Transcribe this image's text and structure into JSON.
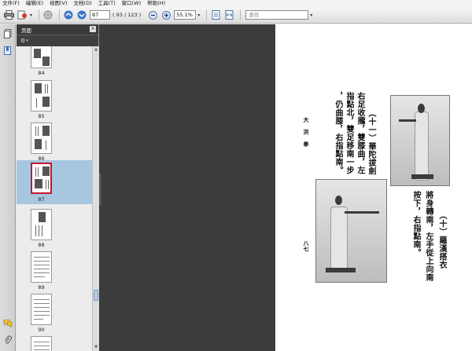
{
  "menu": [
    "文件(F)",
    "编辑(E)",
    "视图(V)",
    "文档(D)",
    "工具(T)",
    "窗口(W)",
    "帮助(H)"
  ],
  "toolbar": {
    "current_page": "87",
    "page_of": "( 93 / 123 )",
    "zoom": "55.1%",
    "find_placeholder": "查找"
  },
  "panel": {
    "title": "页面",
    "close_label": "×"
  },
  "thumbnails": [
    {
      "label": "84",
      "selected": false
    },
    {
      "label": "85",
      "selected": false
    },
    {
      "label": "86",
      "selected": false
    },
    {
      "label": "87",
      "selected": true
    },
    {
      "label": "88",
      "selected": false
    },
    {
      "label": "89",
      "selected": false
    },
    {
      "label": "90",
      "selected": false
    }
  ],
  "page_content": {
    "left_col_1": "（十一）華陀拔劍",
    "left_col_2": "右足收攏，雙膝曲，左",
    "left_col_3": "指點北，雙足移南一步",
    "left_col_4": "，仍曲膝，右指點南。",
    "side_title": "大 洪 拳",
    "page_number": "八七",
    "right_col_1": "（十）羅漢搭衣",
    "right_col_2": "將身轉南，左手從上向南",
    "right_col_3": "按下，右指點南。"
  }
}
